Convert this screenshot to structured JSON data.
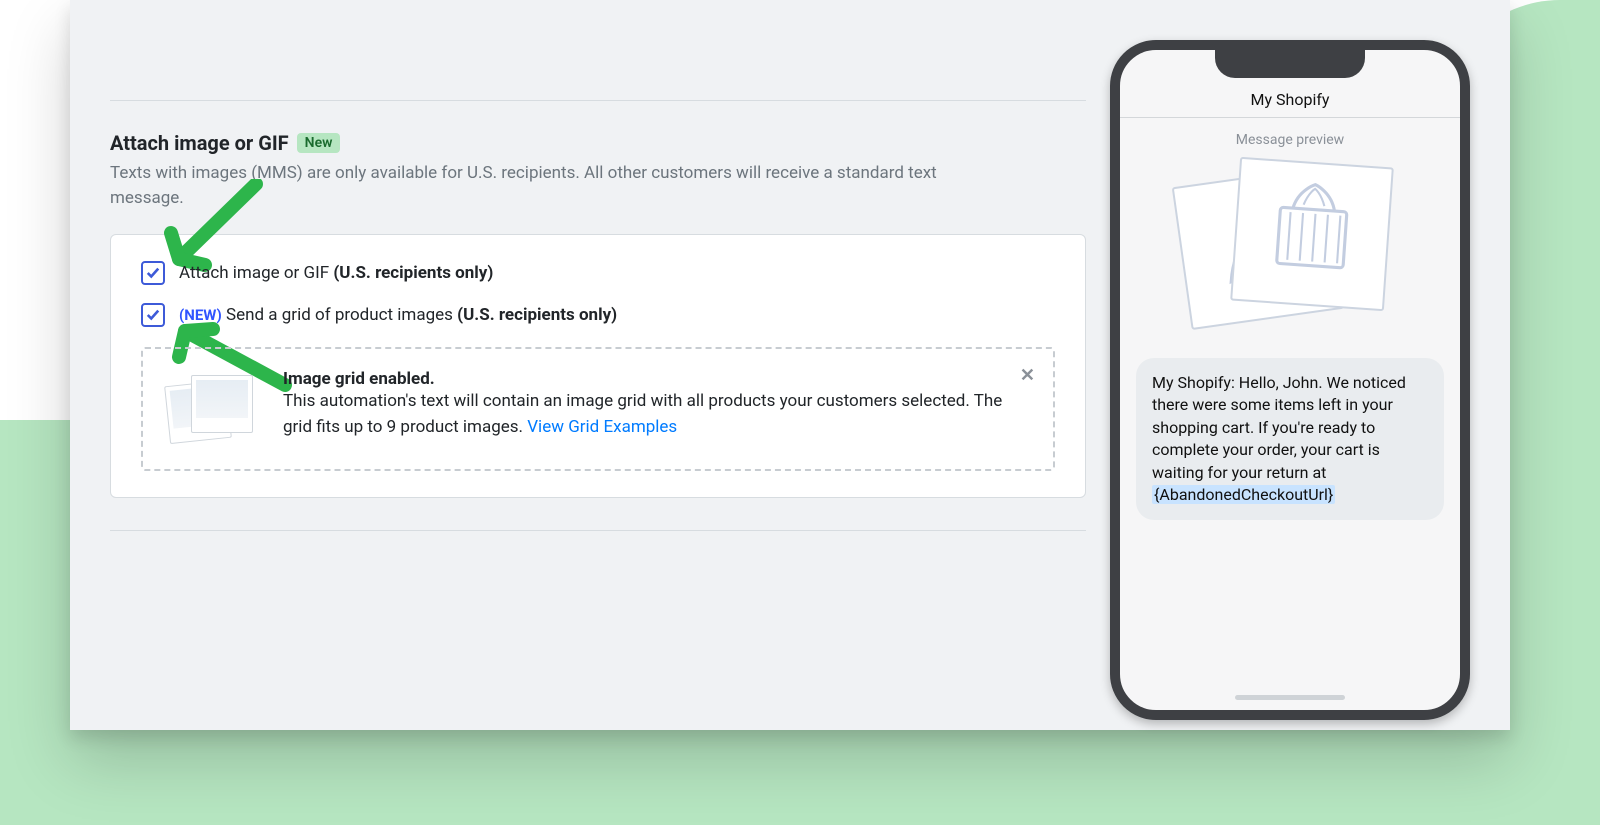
{
  "section": {
    "title": "Attach image or GIF",
    "badge": "New",
    "description": "Texts with images (MMS) are only available for U.S. recipients. All other customers will receive a standard text message."
  },
  "options": {
    "attach": {
      "label": "Attach image or GIF",
      "qualifier": "(U.S. recipients only)",
      "checked": true
    },
    "grid": {
      "new_tag": "(NEW)",
      "label": "Send a grid of product images",
      "qualifier": "(U.S. recipients only)",
      "checked": true
    }
  },
  "grid_info": {
    "title": "Image grid enabled.",
    "text": "This automation's text will contain an image grid with all products your customers selected. The grid fits up to 9 product images.",
    "link": "View Grid Examples",
    "close": "✕"
  },
  "phone": {
    "title": "My Shopify",
    "subtitle": "Message preview",
    "message_text": "My Shopify: Hello, John. We noticed there were some items left in your shopping cart. If you're ready to complete your order, your cart is waiting for your return at ",
    "placeholder_token": "{AbandonedCheckoutUrl}"
  },
  "colors": {
    "link": "#007bff",
    "checkbox": "#3d5ad8",
    "arrow": "#2db54b"
  }
}
